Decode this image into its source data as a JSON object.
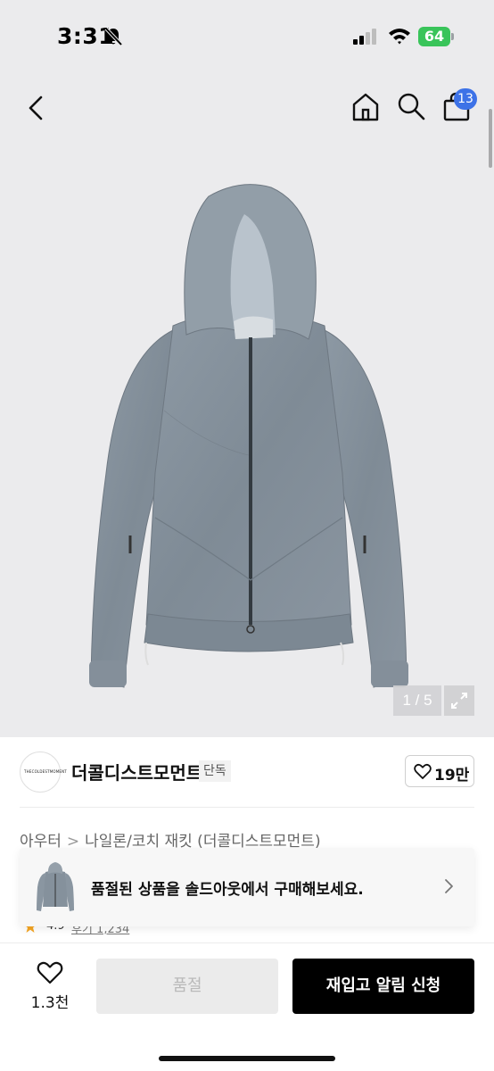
{
  "status_bar": {
    "time": "3:31",
    "battery": "64",
    "colors": {
      "battery": "#39c45a"
    }
  },
  "nav": {
    "cart_count": "13",
    "icons": [
      "back-icon",
      "home-icon",
      "search-icon",
      "bag-icon"
    ],
    "colors": {
      "badge": "#3d72e7"
    }
  },
  "gallery": {
    "counter": "1 / 5",
    "current_index": 1,
    "total": 5
  },
  "brand": {
    "name": "더콜디스트모먼트",
    "badge": "단독",
    "logo_text": "THECOLDESTMOMENT",
    "like_count": "19만"
  },
  "breadcrumb": {
    "items": [
      "아우터",
      "나일론/코치 재킷 (더콜디스트모먼트)"
    ],
    "separator": ">"
  },
  "soldout_banner": {
    "text": "품절된 상품을 솔드아웃에서 구매해보세요."
  },
  "rating_peek": {
    "value": "4.9",
    "link": "후기 1,234개"
  },
  "bottom_bar": {
    "wish_count": "1.3천",
    "soldout_label": "품절",
    "restock_label": "재입고 알림 신청",
    "colors": {
      "primary": "#000000",
      "disabled_bg": "#ebebeb",
      "disabled_text": "#b9b9b9"
    }
  }
}
